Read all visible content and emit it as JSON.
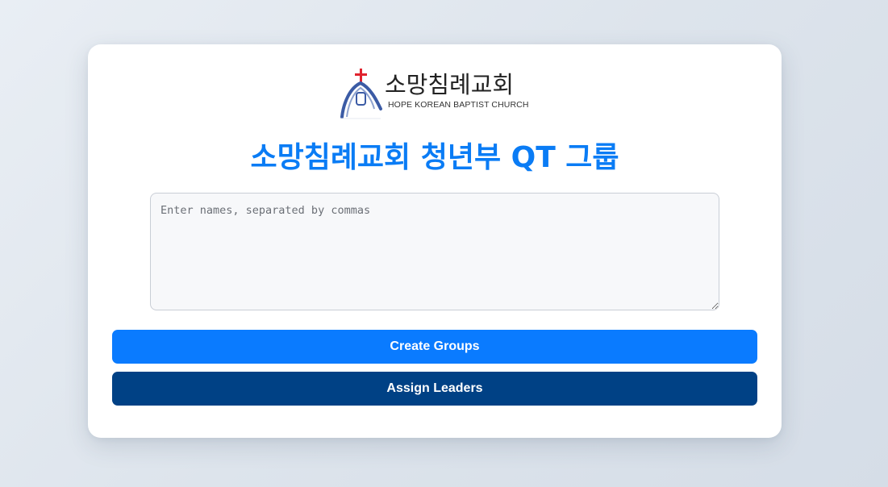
{
  "logo": {
    "korean_name": "소망침례교회",
    "english_name": "HOPE KOREAN BAPTIST CHURCH",
    "icon": "church-cross-icon",
    "colors": {
      "cross": "#e0232e",
      "arch": "#3b5ba5"
    }
  },
  "title": "소망침례교회 청년부 QT 그룹",
  "names_input": {
    "value": "",
    "placeholder": "Enter names, separated by commas"
  },
  "buttons": {
    "create_label": "Create Groups",
    "assign_label": "Assign Leaders"
  },
  "colors": {
    "title": "#0a7cf5",
    "create_button": "#0a7bff",
    "assign_button": "#004185",
    "card": "#ffffff"
  }
}
